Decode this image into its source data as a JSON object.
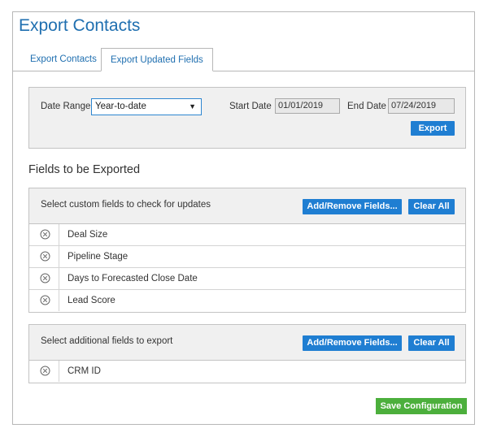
{
  "page": {
    "title": "Export Contacts"
  },
  "tabs": [
    {
      "label": "Export Contacts",
      "active": false
    },
    {
      "label": "Export Updated Fields",
      "active": true
    }
  ],
  "date_range": {
    "label": "Date Range",
    "selected": "Year-to-date",
    "start_label": "Start Date",
    "start_value": "01/01/2019",
    "end_label": "End Date",
    "end_value": "07/24/2019",
    "export_button": "Export"
  },
  "fields_heading": "Fields to be Exported",
  "custom_fields": {
    "heading": "Select custom fields to check for updates",
    "add_remove_button": "Add/Remove Fields...",
    "clear_button": "Clear All",
    "items": [
      "Deal Size",
      "Pipeline Stage",
      "Days to Forecasted Close Date",
      "Lead Score"
    ]
  },
  "additional_fields": {
    "heading": "Select additional fields to export",
    "add_remove_button": "Add/Remove Fields...",
    "clear_button": "Clear All",
    "items": [
      "CRM ID"
    ]
  },
  "save_button": "Save Configuration",
  "colors": {
    "title_blue": "#1f6fb0",
    "button_blue": "#1f7ed2",
    "save_green": "#4caf3c",
    "panel_gray": "#f0f0f0"
  },
  "icons": {
    "remove_field": "circle-x-icon",
    "dropdown": "caret-down-icon"
  }
}
